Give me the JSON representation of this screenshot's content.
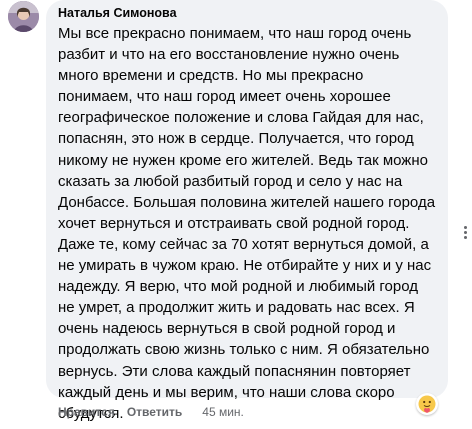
{
  "comment": {
    "author": "Наталья Симонова",
    "text": "Мы все прекрасно понимаем, что наш город очень разбит и что на его восстановление нужно очень много времени и средств. Но мы прекрасно понимаем, что наш город имеет очень хорошее географическое положение и слова Гайдая для нас, попаснян, это нож в сердце. Получается, что город никому не нужен кроме его жителей. Ведь так можно сказать за любой разбитый город и село у нас на Донбассе. Большая половина жителей нашего города хочет вернуться и отстраивать свой родной город. Даже те, кому сейчас за 70 хотят вернуться домой, а не умирать в чужом краю. Не отбирайте у них и у нас надежду. Я верю, что мой родной и любимый город не умрет, а продолжит жить и радовать нас всех. Я очень надеюсь вернуться в свой родной город и продолжать свою жизнь только с ним. Я обязательно вернусь. Эти слова каждый попаснянин повторяет каждый день и мы верим, что наши слова скоро сбудутся.",
    "reaction_icon": "care-emoji-icon"
  },
  "actions": {
    "like_label": "Нравится",
    "reply_label": "Ответить",
    "time": "45 мин."
  },
  "colors": {
    "bubble": "#f0f2f5",
    "text": "#050505",
    "secondary": "#65676b"
  }
}
